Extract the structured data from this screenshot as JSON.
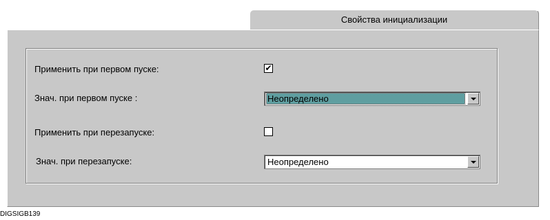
{
  "tab": {
    "label": "Свойства инициализации"
  },
  "rows": [
    {
      "label": "Применить при первом пуске:",
      "checked": "✔"
    },
    {
      "label": "Знач. при первом пуске :",
      "value": "Неопределено"
    },
    {
      "label": "Применить при перезапуске:",
      "checked": ""
    },
    {
      "label": "Знач. при перезапуске:",
      "value": "Неопределено"
    }
  ],
  "footer": {
    "caption": "DIGSIGB139"
  },
  "colors": {
    "selection": "#5f9ea0",
    "panel": "#c8c8c8"
  }
}
